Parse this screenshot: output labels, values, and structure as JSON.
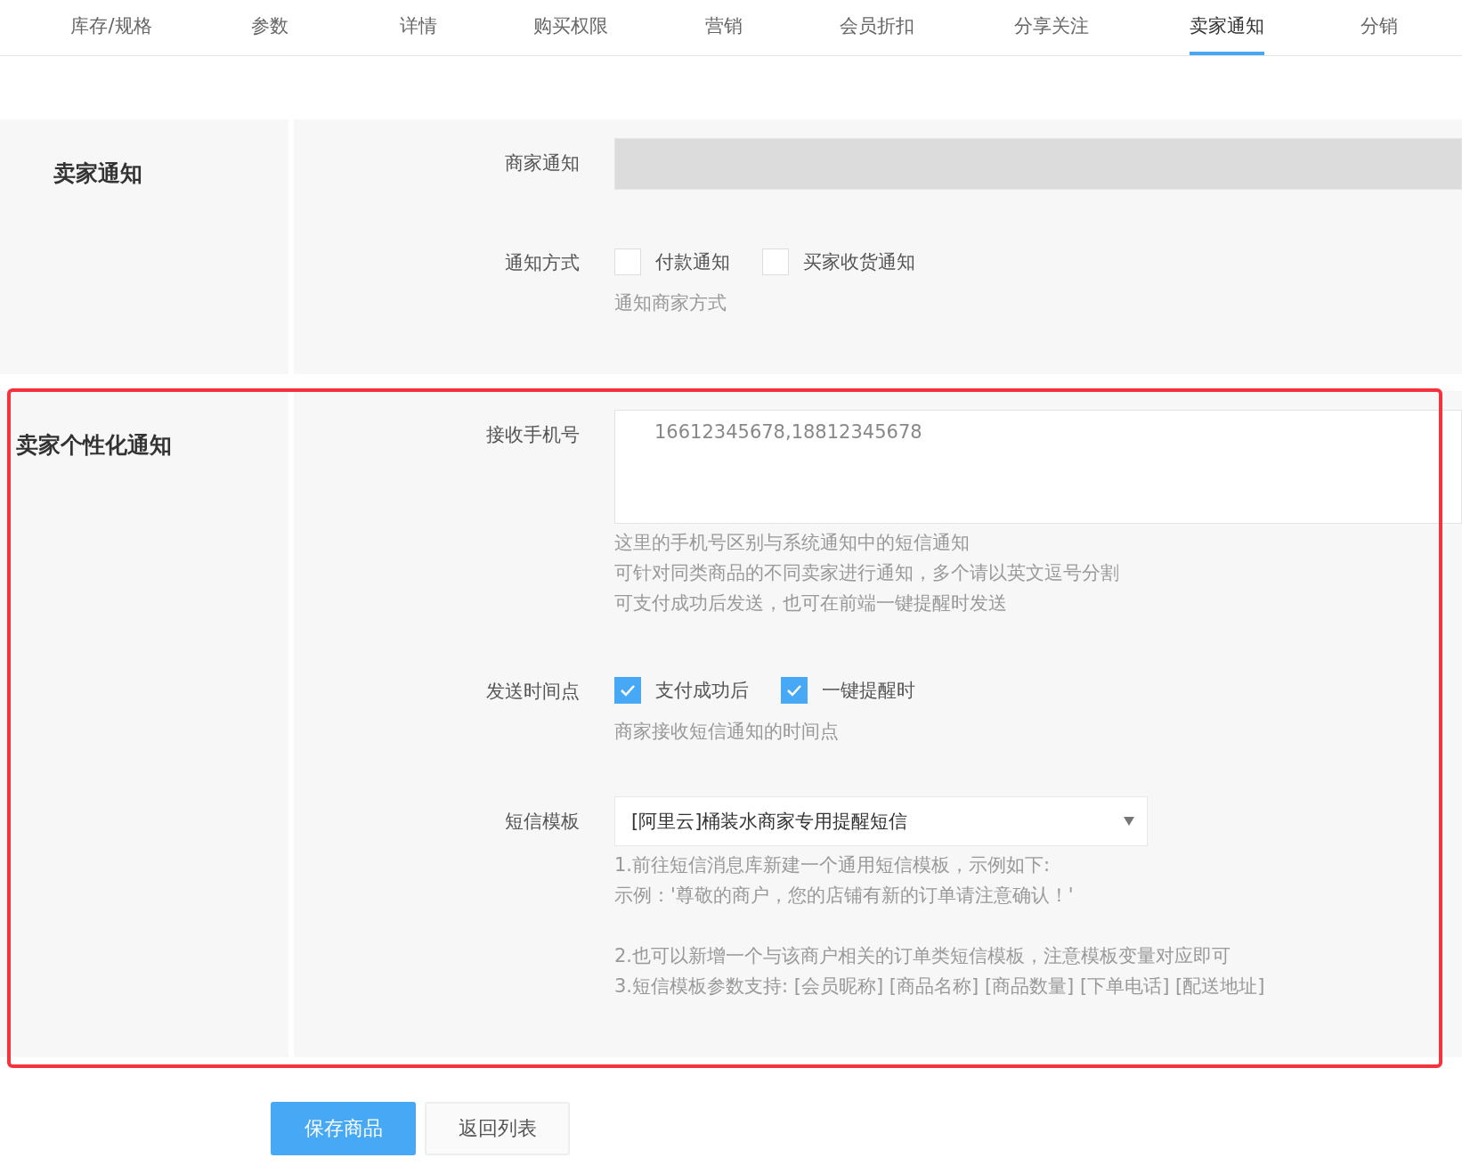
{
  "tabs": [
    {
      "label": "库存/规格",
      "selected": false
    },
    {
      "label": "参数",
      "selected": false
    },
    {
      "label": "详情",
      "selected": false
    },
    {
      "label": "购买权限",
      "selected": false
    },
    {
      "label": "营销",
      "selected": false
    },
    {
      "label": "会员折扣",
      "selected": false
    },
    {
      "label": "分享关注",
      "selected": false
    },
    {
      "label": "卖家通知",
      "selected": true
    },
    {
      "label": "分销",
      "selected": false
    }
  ],
  "sections": [
    {
      "title": "卖家通知",
      "highlighted": false,
      "fields": [
        {
          "kind": "input",
          "label": "商家通知",
          "disabled": true
        },
        {
          "kind": "checkboxes",
          "label": "通知方式",
          "options": [
            {
              "label": "付款通知",
              "checked": false
            },
            {
              "label": "买家收货通知",
              "checked": false
            }
          ],
          "help": [
            [
              "通知商家方式"
            ]
          ]
        }
      ]
    },
    {
      "title": "卖家个性化通知",
      "highlighted": true,
      "fields": [
        {
          "kind": "textarea",
          "label": "接收手机号",
          "value": "16612345678,18812345678",
          "help": [
            [
              "这里的手机号区别与系统通知中的短信通知",
              "可针对同类商品的不同卖家进行通知，多个请以英文逗号分割",
              "可支付成功后发送，也可在前端一键提醒时发送"
            ]
          ]
        },
        {
          "kind": "checkboxes",
          "label": "发送时间点",
          "options": [
            {
              "label": "支付成功后",
              "checked": true
            },
            {
              "label": "一键提醒时",
              "checked": true
            }
          ],
          "help": [
            [
              "商家接收短信通知的时间点"
            ]
          ]
        },
        {
          "kind": "select",
          "label": "短信模板",
          "value": "[阿里云]桶装水商家专用提醒短信",
          "help": [
            [
              "1.前往短信消息库新建一个通用短信模板，示例如下:",
              "示例：'尊敬的商户，您的店铺有新的订单请注意确认！'"
            ],
            [
              "2.也可以新增一个与该商户相关的订单类短信模板，注意模板变量对应即可",
              "3.短信模板参数支持: [会员昵称] [商品名称] [商品数量] [下单电话] [配送地址]"
            ]
          ]
        }
      ]
    }
  ],
  "buttons": [
    {
      "label": "保存商品",
      "kind": "primary"
    },
    {
      "label": "返回列表",
      "kind": "default"
    }
  ]
}
